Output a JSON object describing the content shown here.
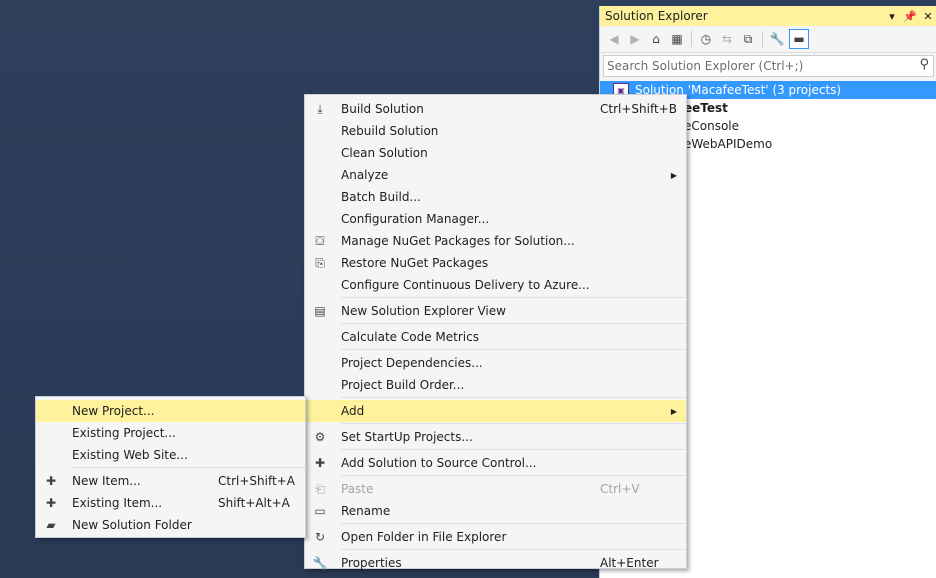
{
  "solution_explorer": {
    "title": "Solution Explorer",
    "pin_glyph": "▾",
    "pin2_glyph": "⊥",
    "close_glyph": "✕",
    "toolbar": [
      "back",
      "forward",
      "home",
      "switch-views",
      "history",
      "sync",
      "collapse",
      "properties",
      "preview"
    ],
    "search_placeholder": "Search Solution Explorer (Ctrl+;)",
    "tree": [
      {
        "text": "Solution 'MacafeeTest' (3 projects)",
        "selected": true
      },
      {
        "text": "eeTest",
        "bold": true
      },
      {
        "text": "eConsole"
      },
      {
        "text": "eWebAPIDemo"
      }
    ]
  },
  "main_menu": {
    "items": [
      {
        "label": "Build Solution",
        "shortcut": "Ctrl+Shift+B",
        "icon": "build-icon",
        "glyph": "⤓"
      },
      {
        "label": "Rebuild Solution"
      },
      {
        "label": "Clean Solution"
      },
      {
        "label": "Analyze",
        "submenu": true
      },
      {
        "label": "Batch Build..."
      },
      {
        "label": "Configuration Manager..."
      },
      {
        "label": "Manage NuGet Packages for Solution...",
        "icon": "nuget-icon",
        "glyph": "⛋"
      },
      {
        "label": "Restore NuGet Packages",
        "icon": "restore-icon",
        "glyph": "⎘"
      },
      {
        "label": "Configure Continuous Delivery to Azure..."
      },
      {
        "sep": true
      },
      {
        "label": "New Solution Explorer View",
        "icon": "new-view-icon",
        "glyph": "▤"
      },
      {
        "sep": true
      },
      {
        "label": "Calculate Code Metrics"
      },
      {
        "sep": true
      },
      {
        "label": "Project Dependencies..."
      },
      {
        "label": "Project Build Order..."
      },
      {
        "sep": true
      },
      {
        "label": "Add",
        "submenu": true,
        "highlight": true
      },
      {
        "sep": true
      },
      {
        "label": "Set StartUp Projects...",
        "icon": "gear-icon",
        "glyph": "⚙"
      },
      {
        "sep": true
      },
      {
        "label": "Add Solution to Source Control...",
        "icon": "source-control-icon",
        "glyph": "✚"
      },
      {
        "sep": true
      },
      {
        "label": "Paste",
        "shortcut": "Ctrl+V",
        "icon": "paste-icon",
        "glyph": "⎗",
        "disabled": true
      },
      {
        "label": "Rename",
        "icon": "rename-icon",
        "glyph": "▭"
      },
      {
        "sep": true
      },
      {
        "label": "Open Folder in File Explorer",
        "icon": "refresh-icon",
        "glyph": "↻"
      },
      {
        "sep": true
      },
      {
        "label": "Properties",
        "shortcut": "Alt+Enter",
        "icon": "wrench-icon",
        "glyph": "🔧"
      }
    ]
  },
  "add_menu": {
    "items": [
      {
        "label": "New Project...",
        "highlight": true
      },
      {
        "label": "Existing Project..."
      },
      {
        "label": "Existing Web Site..."
      },
      {
        "sep": true
      },
      {
        "label": "New Item...",
        "shortcut": "Ctrl+Shift+A",
        "icon": "new-item-icon",
        "glyph": "✚"
      },
      {
        "label": "Existing Item...",
        "shortcut": "Shift+Alt+A",
        "icon": "existing-item-icon",
        "glyph": "✚"
      },
      {
        "label": "New Solution Folder",
        "icon": "folder-icon",
        "glyph": "▰"
      }
    ]
  },
  "colors": {
    "highlight": "#fff29d",
    "selection": "#3399ff",
    "background": "#2b3c59"
  }
}
